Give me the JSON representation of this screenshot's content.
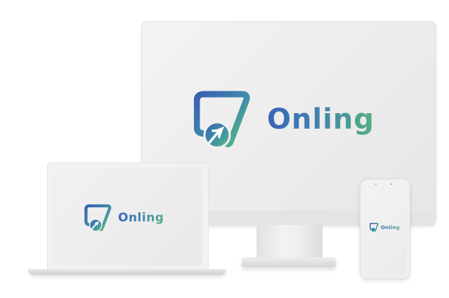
{
  "brand": {
    "name": "Onling",
    "colors": {
      "primary": "#3a66b5",
      "secondary": "#55b07f"
    },
    "icon": "chat-bubble-cursor-icon"
  },
  "devices": [
    "desktop-monitor",
    "laptop",
    "smartphone"
  ]
}
